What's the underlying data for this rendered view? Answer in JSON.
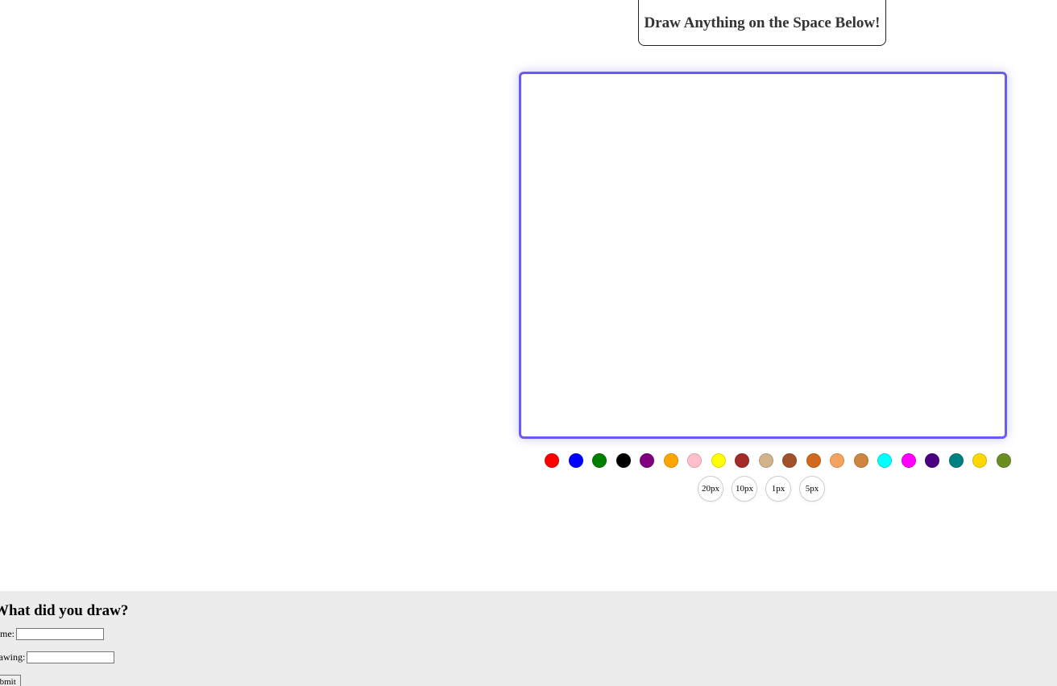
{
  "header": {
    "title": "Draw Anything on the Space Below!"
  },
  "palette": {
    "colors": [
      {
        "name": "red",
        "hex": "#ff0000"
      },
      {
        "name": "blue",
        "hex": "#0000ff"
      },
      {
        "name": "green",
        "hex": "#008000"
      },
      {
        "name": "black",
        "hex": "#000000"
      },
      {
        "name": "purple",
        "hex": "#800080"
      },
      {
        "name": "orange",
        "hex": "#ffa500"
      },
      {
        "name": "pink",
        "hex": "#ffc0cb"
      },
      {
        "name": "yellow",
        "hex": "#ffff00"
      },
      {
        "name": "brown",
        "hex": "#a52a2a"
      },
      {
        "name": "tan",
        "hex": "#d2b48c"
      },
      {
        "name": "sienna",
        "hex": "#a0522d"
      },
      {
        "name": "chocolate",
        "hex": "#d2691e"
      },
      {
        "name": "sandy-brown",
        "hex": "#f4a460"
      },
      {
        "name": "peru",
        "hex": "#cd853f"
      },
      {
        "name": "cyan",
        "hex": "#00ffff"
      },
      {
        "name": "magenta",
        "hex": "#ff00ff"
      },
      {
        "name": "indigo",
        "hex": "#4b0082"
      },
      {
        "name": "teal",
        "hex": "#008080"
      },
      {
        "name": "gold",
        "hex": "#ffd700"
      },
      {
        "name": "olive",
        "hex": "#6b8e23"
      }
    ],
    "accent": "#6a5cf0"
  },
  "sizes": [
    "20px",
    "10px",
    "1px",
    "5px"
  ],
  "form": {
    "heading": "What did you draw?",
    "name_label": "Name:",
    "drawing_label": "Drawing:",
    "name_value": "",
    "drawing_value": "",
    "submit_label": "Submit"
  }
}
